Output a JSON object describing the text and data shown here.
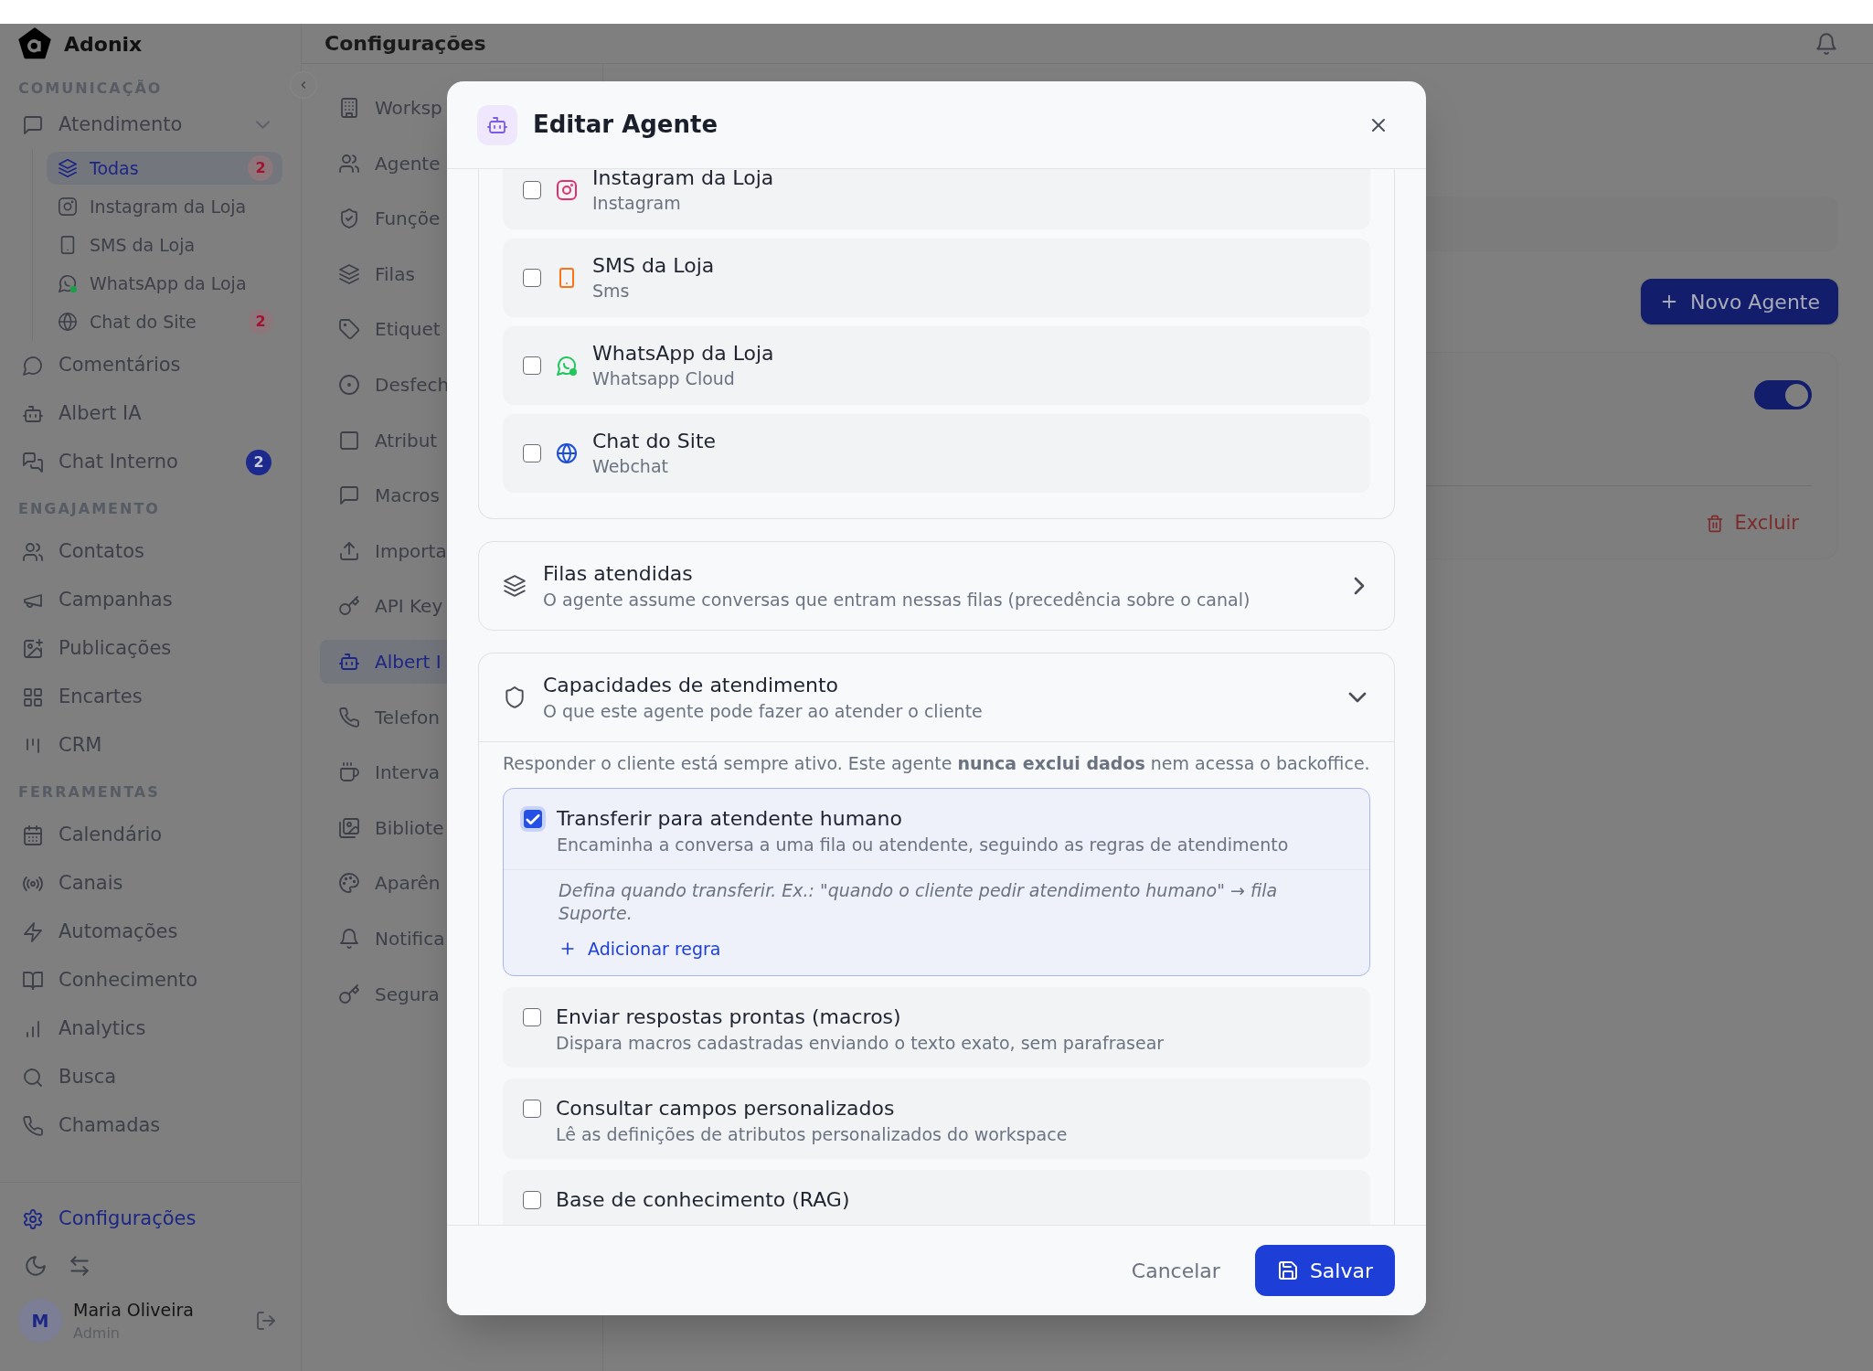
{
  "brand": {
    "name": "Adonix"
  },
  "sidebar": {
    "sections": [
      {
        "heading": "COMUNICAÇÃO",
        "items": [
          {
            "label": "Atendimento",
            "selected": false,
            "expanded": true,
            "children": [
              {
                "label": "Todas",
                "selected": true,
                "badge": {
                  "text": "2",
                  "kind": "soft"
                }
              },
              {
                "label": "Instagram da Loja",
                "selected": false
              },
              {
                "label": "SMS da Loja",
                "selected": false
              },
              {
                "label": "WhatsApp da Loja",
                "selected": false
              },
              {
                "label": "Chat do Site",
                "selected": false,
                "badge": {
                  "text": "2",
                  "kind": "soft"
                }
              }
            ]
          },
          {
            "label": "Comentários",
            "selected": false
          },
          {
            "label": "Albert IA",
            "selected": false
          },
          {
            "label": "Chat Interno",
            "selected": false,
            "badge": {
              "text": "2",
              "kind": "solid"
            }
          }
        ]
      },
      {
        "heading": "ENGAJAMENTO",
        "items": [
          {
            "label": "Contatos",
            "selected": false
          },
          {
            "label": "Campanhas",
            "selected": false
          },
          {
            "label": "Publicações",
            "selected": false
          },
          {
            "label": "Encartes",
            "selected": false
          },
          {
            "label": "CRM",
            "selected": false
          }
        ]
      },
      {
        "heading": "FERRAMENTAS",
        "items": [
          {
            "label": "Calendário",
            "selected": false
          },
          {
            "label": "Canais",
            "selected": false
          },
          {
            "label": "Automações",
            "selected": false
          },
          {
            "label": "Conhecimento",
            "selected": false
          },
          {
            "label": "Analytics",
            "selected": false
          },
          {
            "label": "Busca",
            "selected": false
          },
          {
            "label": "Chamadas",
            "selected": false
          }
        ]
      }
    ],
    "footer_item": {
      "label": "Configurações",
      "selected": true
    },
    "user": {
      "initial": "M",
      "name": "Maria Oliveira",
      "role": "Admin"
    }
  },
  "header": {
    "title": "Configurações"
  },
  "settings_nav": {
    "items": [
      {
        "label": "Worksp",
        "selected": false
      },
      {
        "label": "Agente",
        "selected": false
      },
      {
        "label": "Funçõe",
        "selected": false
      },
      {
        "label": "Filas",
        "selected": false
      },
      {
        "label": "Etiquet",
        "selected": false
      },
      {
        "label": "Desfech",
        "selected": false
      },
      {
        "label": "Atribut",
        "selected": false
      },
      {
        "label": "Macros",
        "selected": false
      },
      {
        "label": "Importa",
        "selected": false
      },
      {
        "label": "API Key",
        "selected": false
      },
      {
        "label": "Albert I",
        "selected": true
      },
      {
        "label": "Telefon",
        "selected": false
      },
      {
        "label": "Interva",
        "selected": false
      },
      {
        "label": "Bibliote",
        "selected": false
      },
      {
        "label": "Aparên",
        "selected": false
      },
      {
        "label": "Notifica",
        "selected": false
      },
      {
        "label": "Segura",
        "selected": false
      }
    ]
  },
  "main": {
    "new_button": "Novo Agente",
    "agent_card": {
      "enabled": true,
      "delete_label": "Excluir"
    }
  },
  "modal": {
    "title": "Editar Agente",
    "channels": [
      {
        "name": "Instagram da Loja",
        "type": "Instagram",
        "checked": false
      },
      {
        "name": "SMS da Loja",
        "type": "Sms",
        "checked": false
      },
      {
        "name": "WhatsApp da Loja",
        "type": "Whatsapp Cloud",
        "checked": false
      },
      {
        "name": "Chat do Site",
        "type": "Webchat",
        "checked": false
      }
    ],
    "queues_section": {
      "title": "Filas atendidas",
      "subtitle": "O agente assume conversas que entram nessas filas (precedência sobre o canal)",
      "expanded": false
    },
    "capabilities_section": {
      "title": "Capacidades de atendimento",
      "subtitle": "O que este agente pode fazer ao atender o cliente",
      "expanded": true,
      "note": "Responder o cliente está sempre ativo. Este agente **nunca exclui dados** nem acessa o backoffice.",
      "items": [
        {
          "title": "Transferir para atendente humano",
          "description": "Encaminha a conversa a uma fila ou atendente, seguindo as regras de atendimento",
          "checked": true,
          "rules_hint": "Defina quando transferir. Ex.: \"quando o cliente pedir atendimento humano\" → fila Suporte.",
          "add_rule_label": "Adicionar regra"
        },
        {
          "title": "Enviar respostas prontas (macros)",
          "description": "Dispara macros cadastradas enviando o texto exato, sem parafrasear",
          "checked": false
        },
        {
          "title": "Consultar campos personalizados",
          "description": "Lê as definições de atributos personalizados do workspace",
          "checked": false
        },
        {
          "title": "Base de conhecimento (RAG)",
          "checked": false
        }
      ]
    },
    "cancel_label": "Cancelar",
    "save_label": "Salvar"
  }
}
